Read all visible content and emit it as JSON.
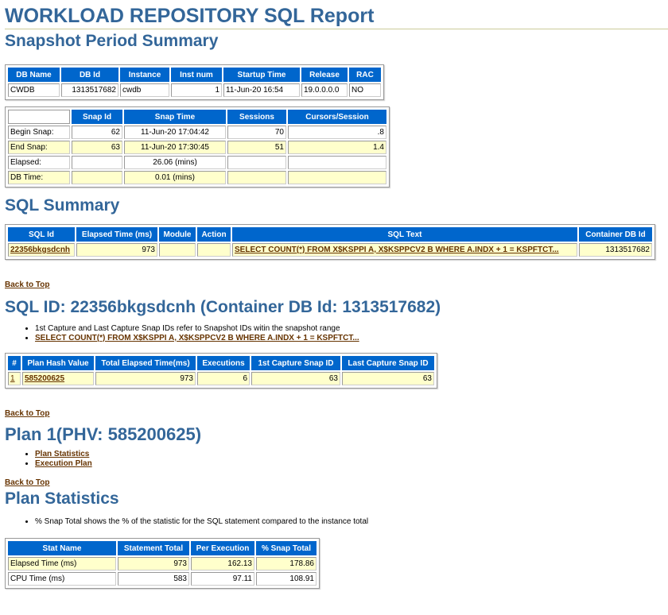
{
  "title": "WORKLOAD REPOSITORY SQL Report",
  "snapshot_period_summary": {
    "heading": "Snapshot Period Summary",
    "db_table": {
      "headers": [
        "DB Name",
        "DB Id",
        "Instance",
        "Inst num",
        "Startup Time",
        "Release",
        "RAC"
      ],
      "row": [
        "CWDB",
        "1313517682",
        "cwdb",
        "1",
        "11-Jun-20 16:54",
        "19.0.0.0.0",
        "NO"
      ]
    },
    "snap_table": {
      "headers": [
        "",
        "Snap Id",
        "Snap Time",
        "Sessions",
        "Cursors/Session"
      ],
      "rows": [
        [
          "Begin Snap:",
          "62",
          "11-Jun-20 17:04:42",
          "70",
          ".8"
        ],
        [
          "End Snap:",
          "63",
          "11-Jun-20 17:30:45",
          "51",
          "1.4"
        ],
        [
          "Elapsed:",
          "",
          "26.06 (mins)",
          "",
          ""
        ],
        [
          "DB Time:",
          "",
          "0.01 (mins)",
          "",
          ""
        ]
      ]
    }
  },
  "sql_summary": {
    "heading": "SQL Summary",
    "headers": [
      "SQL Id",
      "Elapsed Time (ms)",
      "Module",
      "Action",
      "SQL Text",
      "Container DB Id"
    ],
    "row": [
      "22356bkgsdcnh",
      "973",
      "",
      "",
      "SELECT COUNT(*) FROM X$KSPPI A, X$KSPPCV2 B WHERE A.INDX + 1 = KSPFTCT...",
      "1313517682"
    ]
  },
  "back_to_top": "Back to Top",
  "sql_id_section": {
    "heading": "SQL ID: 22356bkgsdcnh (Container DB Id: 1313517682)",
    "notes": [
      "1st Capture and Last Capture Snap IDs refer to Snapshot IDs witin the snapshot range",
      "SELECT COUNT(*) FROM X$KSPPI A, X$KSPPCV2 B WHERE A.INDX + 1 = KSPFTCT..."
    ],
    "headers": [
      "#",
      "Plan Hash Value",
      "Total Elapsed Time(ms)",
      "Executions",
      "1st Capture Snap ID",
      "Last Capture Snap ID"
    ],
    "row": [
      "1",
      "585200625",
      "973",
      "6",
      "63",
      "63"
    ]
  },
  "plan_section": {
    "heading": "Plan 1(PHV: 585200625)",
    "links": [
      "Plan Statistics",
      "Execution Plan"
    ]
  },
  "plan_statistics": {
    "heading": "Plan Statistics",
    "note": "% Snap Total shows the % of the statistic for the SQL statement compared to the instance total",
    "headers": [
      "Stat Name",
      "Statement Total",
      "Per Execution",
      "% Snap Total"
    ],
    "rows": [
      [
        "Elapsed Time (ms)",
        "973",
        "162.13",
        "178.86"
      ],
      [
        "CPU Time (ms)",
        "583",
        "97.11",
        "108.91"
      ]
    ]
  }
}
